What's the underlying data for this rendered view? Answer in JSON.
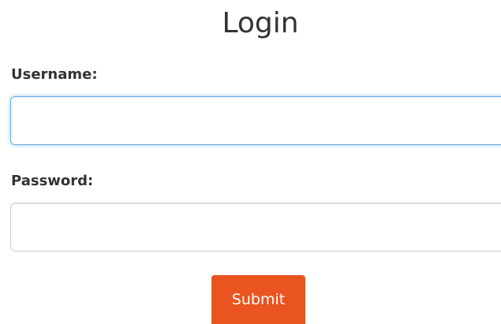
{
  "form": {
    "title": "Login",
    "username": {
      "label": "Username:",
      "value": "",
      "placeholder": ""
    },
    "password": {
      "label": "Password:",
      "value": "",
      "placeholder": ""
    },
    "submit_label": "Submit"
  },
  "colors": {
    "accent": "#e95420",
    "focus_border": "#66afe9",
    "text": "#333333"
  }
}
